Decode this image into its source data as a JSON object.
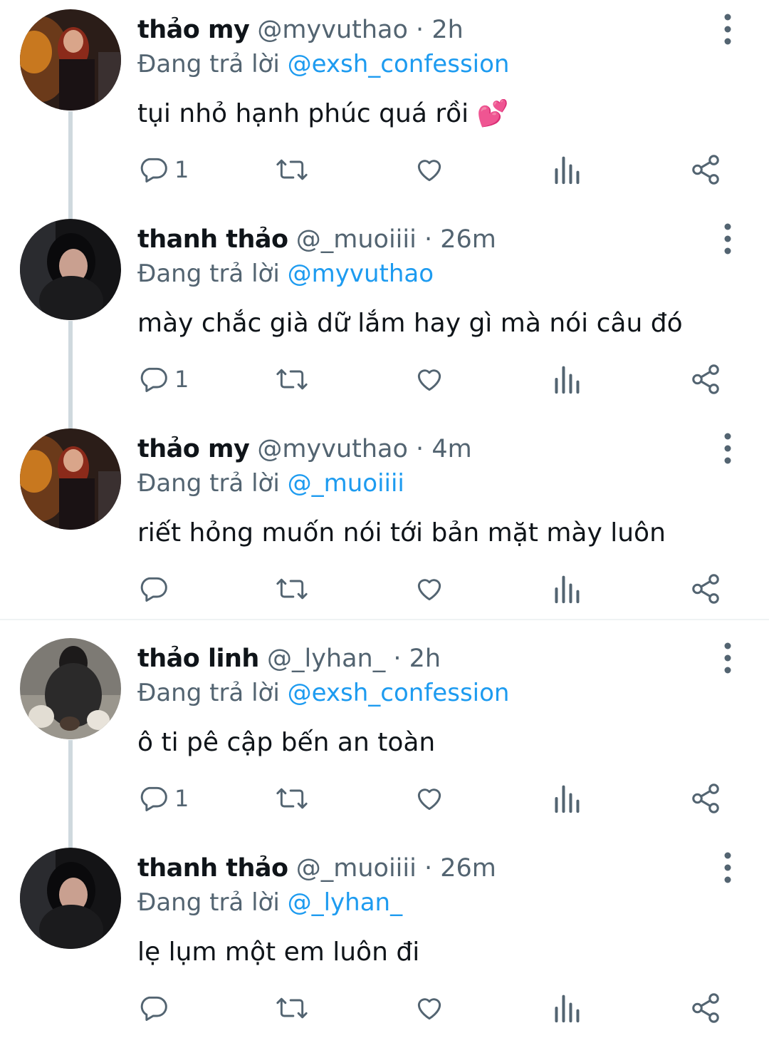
{
  "reply_prefix": "Đang trả lời",
  "tweets": [
    {
      "name": "thảo my",
      "handle": "@myvuthao",
      "sep": "·",
      "time": "2h",
      "reply_to": "@exsh_confession",
      "text": "tụi nhỏ hạnh phúc quá rồi 💕",
      "reply_count": "1",
      "avatar": "avatar-thao-my"
    },
    {
      "name": "thanh thảo",
      "handle": "@_muoiiii",
      "sep": "·",
      "time": "26m",
      "reply_to": "@myvuthao",
      "text": "mày chắc già dữ lắm hay gì mà nói câu đó",
      "reply_count": "1",
      "avatar": "avatar-thanh-thao"
    },
    {
      "name": "thảo my",
      "handle": "@myvuthao",
      "sep": "·",
      "time": "4m",
      "reply_to": "@_muoiiii",
      "text": "riết hỏng muốn nói tới bản mặt mày luôn",
      "reply_count": "",
      "avatar": "avatar-thao-my"
    },
    {
      "name": "thảo linh",
      "handle": "@_lyhan_",
      "sep": "·",
      "time": "2h",
      "reply_to": "@exsh_confession",
      "text": "ô ti pê cập bến an toàn",
      "reply_count": "1",
      "avatar": "avatar-thao-linh"
    },
    {
      "name": "thanh thảo",
      "handle": "@_muoiiii",
      "sep": "·",
      "time": "26m",
      "reply_to": "@_lyhan_",
      "text": "lẹ lụm một em luôn đi",
      "reply_count": "",
      "avatar": "avatar-thanh-thao"
    }
  ],
  "icons": {
    "reply": "reply-icon",
    "retweet": "retweet-icon",
    "like": "heart-icon",
    "views": "analytics-icon",
    "share": "share-icon",
    "more": "more-vertical-icon"
  },
  "colors": {
    "mention": "#1d9bf0",
    "secondary": "#536471",
    "text": "#0f1419",
    "thread_line": "#cfd9de"
  }
}
